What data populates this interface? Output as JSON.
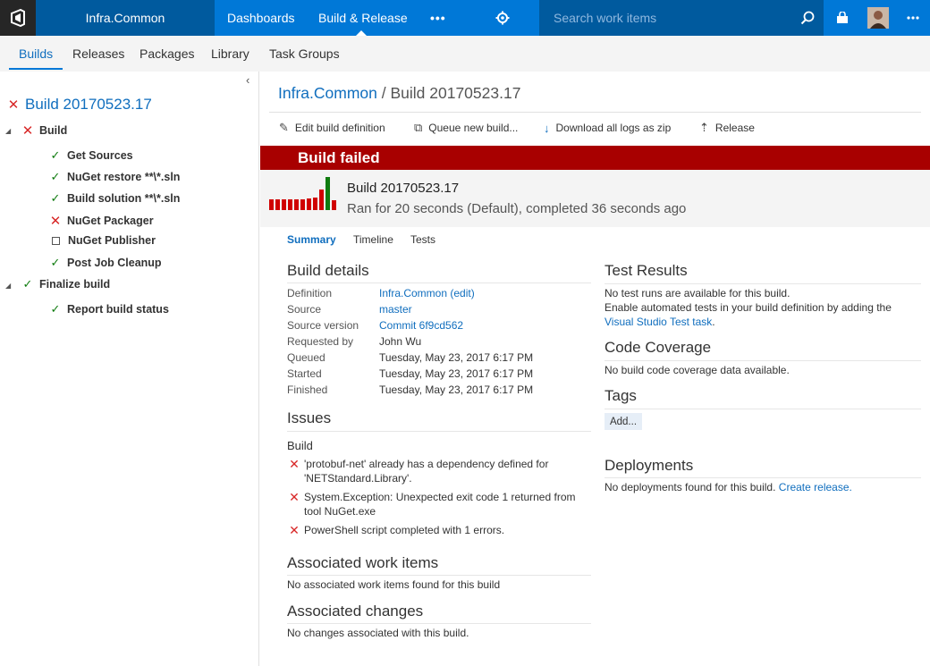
{
  "topbar": {
    "project": "Infra.Common",
    "nav": [
      "Dashboards",
      "Build & Release"
    ],
    "more_label": "•••",
    "search_placeholder": "Search work items",
    "colors": {
      "brand": "#0078d7",
      "dark": "#005a9e"
    }
  },
  "hub_tabs": [
    "Builds",
    "Releases",
    "Packages",
    "Library",
    "Task Groups"
  ],
  "tree": {
    "title": "Build 20170523.17",
    "items": [
      {
        "label": "Build",
        "status": "failed"
      },
      {
        "label": "Get Sources",
        "status": "succeeded"
      },
      {
        "label": "NuGet restore **\\*.sln",
        "status": "succeeded"
      },
      {
        "label": "Build solution **\\*.sln",
        "status": "succeeded"
      },
      {
        "label": "NuGet Packager",
        "status": "failed"
      },
      {
        "label": "NuGet Publisher",
        "status": "not-run"
      },
      {
        "label": "Post Job Cleanup",
        "status": "succeeded"
      },
      {
        "label": "Finalize build",
        "status": "succeeded"
      },
      {
        "label": "Report build status",
        "status": "succeeded"
      }
    ]
  },
  "breadcrumb": {
    "project": "Infra.Common",
    "separator": " / ",
    "build": "Build 20170523.17"
  },
  "toolbar": {
    "edit": "Edit build definition",
    "queue": "Queue new build...",
    "download": "Download all logs as zip",
    "release": "Release"
  },
  "banner": {
    "text": "Build failed",
    "color": "#a80000"
  },
  "build_header": {
    "title": "Build 20170523.17",
    "subtitle": "Ran for 20 seconds (Default), completed 36 seconds ago",
    "history": [
      {
        "value": 0.33,
        "status": "failed"
      },
      {
        "value": 0.33,
        "status": "failed"
      },
      {
        "value": 0.33,
        "status": "failed"
      },
      {
        "value": 0.33,
        "status": "failed"
      },
      {
        "value": 0.33,
        "status": "failed"
      },
      {
        "value": 0.33,
        "status": "failed"
      },
      {
        "value": 0.36,
        "status": "failed"
      },
      {
        "value": 0.39,
        "status": "failed"
      },
      {
        "value": 0.63,
        "status": "failed"
      },
      {
        "value": 1.0,
        "status": "succeeded"
      },
      {
        "value": 0.3,
        "status": "failed"
      }
    ]
  },
  "subtabs": [
    "Summary",
    "Tests",
    "Timeline"
  ],
  "build_details": {
    "heading": "Build details",
    "rows": [
      {
        "key": "Definition",
        "value": "Infra.Common (edit)",
        "link": true
      },
      {
        "key": "Source",
        "value": "master",
        "link": true
      },
      {
        "key": "Source version",
        "value": "Commit 6f9cd562",
        "link": true
      },
      {
        "key": "Requested by",
        "value": "John Wu",
        "link": false
      },
      {
        "key": "Queued",
        "value": "Tuesday, May 23, 2017 6:17 PM",
        "link": false
      },
      {
        "key": "Started",
        "value": "Tuesday, May 23, 2017 6:17 PM",
        "link": false
      },
      {
        "key": "Finished",
        "value": "Tuesday, May 23, 2017 6:17 PM",
        "link": false
      }
    ]
  },
  "issues": {
    "heading": "Issues",
    "group": "Build",
    "items": [
      [
        "'protobuf-net' already has a dependency defined for",
        "'NETStandard.Library'."
      ],
      [
        "System.Exception: Unexpected exit code 1 returned from",
        "tool NuGet.exe"
      ],
      [
        "PowerShell script completed with 1 errors."
      ]
    ]
  },
  "work_items": {
    "heading": "Associated work items",
    "text": "No associated work items found for this build"
  },
  "changes": {
    "heading": "Associated changes",
    "text": "No changes associated with this build."
  },
  "test_results": {
    "heading": "Test Results",
    "line1": "No test runs are available for this build.",
    "line2": "Enable automated tests in your build definition by adding the",
    "link": "Visual Studio Test task",
    "link_suffix": "."
  },
  "coverage": {
    "heading": "Code Coverage",
    "text": "No build code coverage data available."
  },
  "tags": {
    "heading": "Tags",
    "add": "Add..."
  },
  "deployments": {
    "heading": "Deployments",
    "text": "No deployments found for this build.",
    "link": "Create release."
  }
}
